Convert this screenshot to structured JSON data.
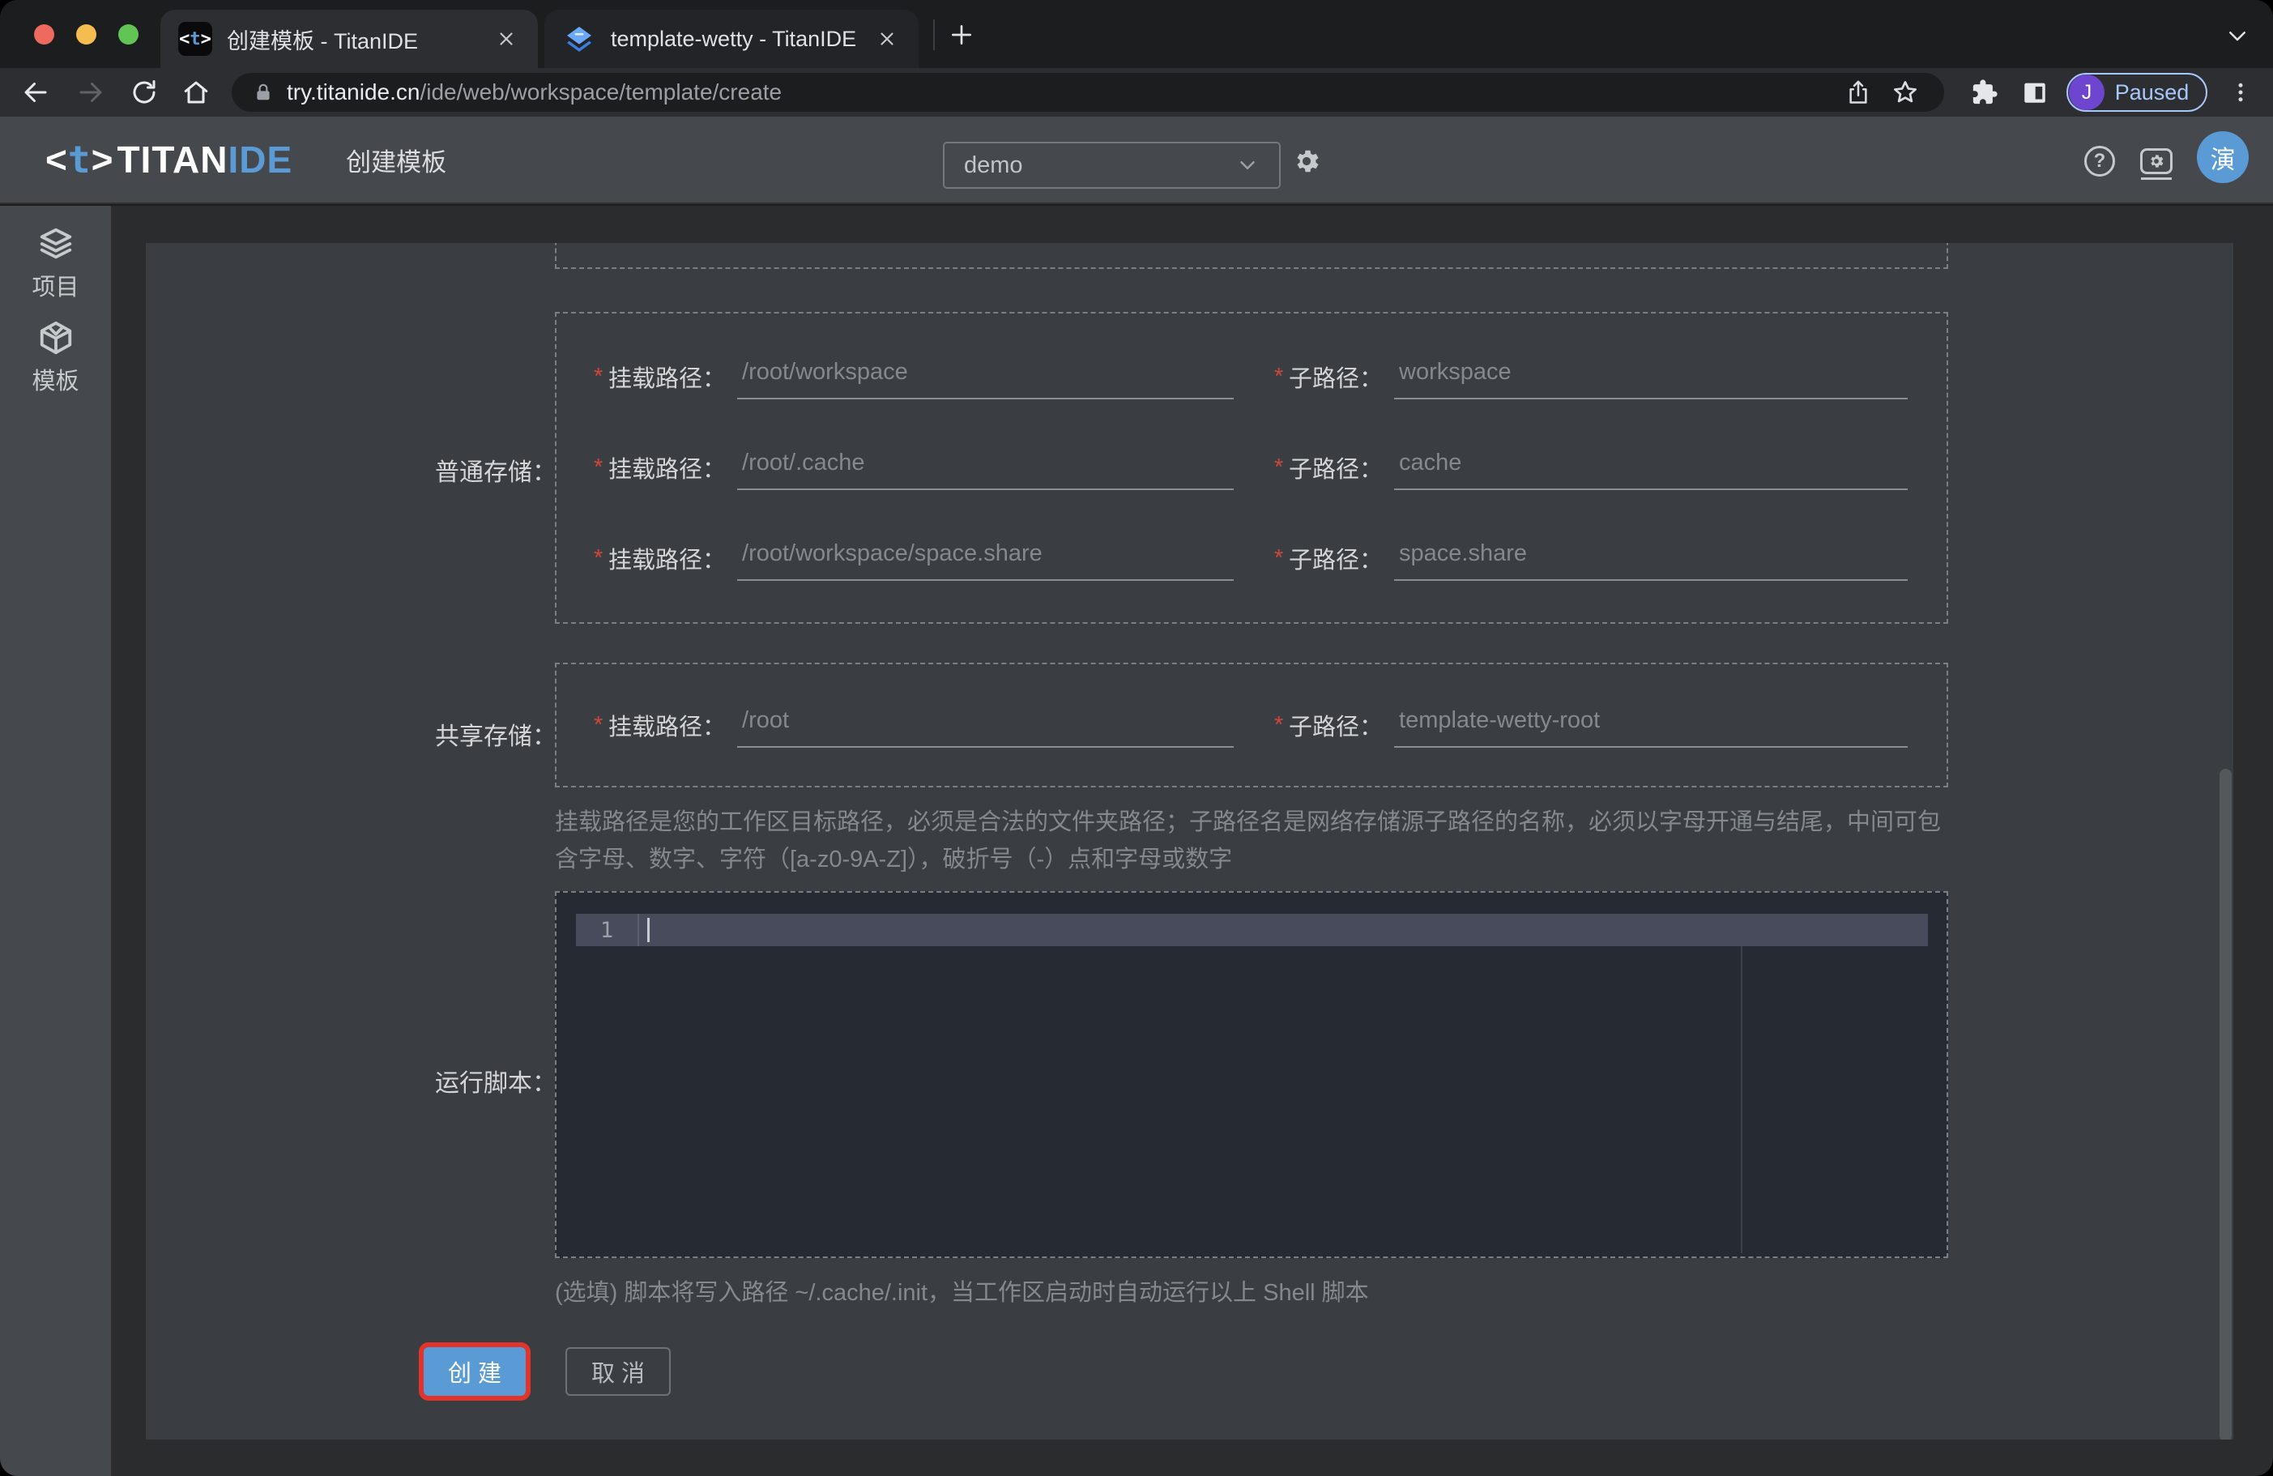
{
  "browser": {
    "tabs": [
      {
        "title": "创建模板 - TitanIDE",
        "active": true
      },
      {
        "title": "template-wetty - TitanIDE",
        "active": false
      }
    ],
    "url": {
      "host": "try.titanide.cn",
      "path": "/ide/web/workspace/template/create"
    },
    "profile": {
      "avatar_initial": "J",
      "status": "Paused"
    }
  },
  "app": {
    "logo": {
      "mark_open": "<",
      "mark_t": "t",
      "mark_close": ">",
      "titan": "TITAN",
      "ide": "IDE"
    },
    "page_title": "创建模板",
    "workspace_dropdown": "demo",
    "avatar": "演",
    "help_glyph": "?"
  },
  "sidebar": {
    "items": [
      {
        "id": "projects",
        "label": "项目"
      },
      {
        "id": "templates",
        "label": "模板"
      }
    ]
  },
  "form": {
    "required_marker": "*",
    "mount_label": "挂载路径：",
    "sub_label": "子路径：",
    "sections": {
      "normal": {
        "label": "普通存储：",
        "rows": [
          {
            "mount": "/root/workspace",
            "sub": "workspace"
          },
          {
            "mount": "/root/.cache",
            "sub": "cache"
          },
          {
            "mount": "/root/workspace/space.share",
            "sub": "space.share"
          }
        ]
      },
      "shared": {
        "label": "共享存储：",
        "rows": [
          {
            "mount": "/root",
            "sub": "template-wetty-root"
          }
        ]
      }
    },
    "path_hint": "挂载路径是您的工作区目标路径，必须是合法的文件夹路径；子路径名是网络存储源子路径的名称，必须以字母开通与结尾，中间可包含字母、数字、字符（[a-z0-9A-Z]），破折号（-）点和字母或数字",
    "script_label": "运行脚本：",
    "script_line_number": "1",
    "script_hint": "(选填) 脚本将写入路径 ~/.cache/.init，当工作区启动时自动运行以上 Shell 脚本",
    "create_button": "创 建",
    "cancel_button": "取 消"
  },
  "colors": {
    "accent_blue": "#5b9bd5",
    "annotation_red": "#e2342b",
    "paused_blue": "#a8c7fa",
    "profile_purple": "#6e45cf",
    "traffic_red": "#ee6a5f",
    "traffic_yellow": "#f5bd4f",
    "traffic_green": "#61c454"
  }
}
